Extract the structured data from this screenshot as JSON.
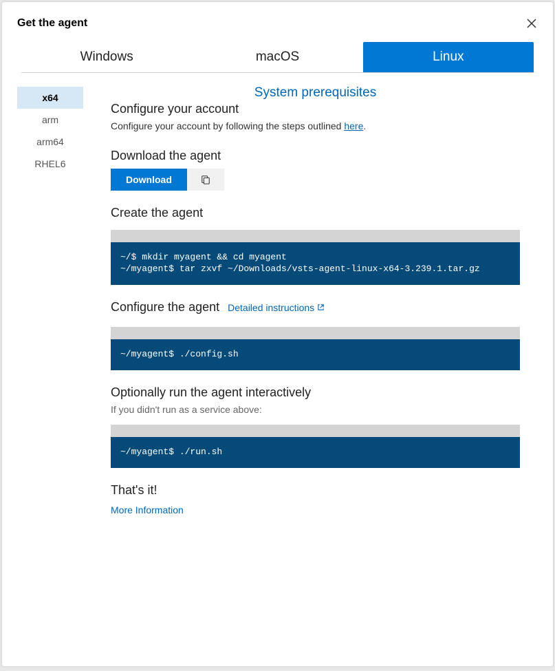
{
  "header": {
    "title": "Get the agent"
  },
  "tabs": [
    "Windows",
    "macOS",
    "Linux"
  ],
  "sidebar": [
    "x64",
    "arm",
    "arm64",
    "RHEL6"
  ],
  "sysPrereq": "System prerequisites",
  "configureAccount": {
    "title": "Configure your account",
    "desc_pre": "Configure your account by following the steps outlined ",
    "desc_link": "here",
    "desc_post": "."
  },
  "download": {
    "title": "Download the agent",
    "button": "Download"
  },
  "create": {
    "title": "Create the agent",
    "code": "~/$ mkdir myagent && cd myagent\n~/myagent$ tar zxvf ~/Downloads/vsts-agent-linux-x64-3.239.1.tar.gz"
  },
  "configureAgent": {
    "title": "Configure the agent",
    "detailed": "Detailed instructions",
    "code": "~/myagent$ ./config.sh"
  },
  "optional": {
    "title": "Optionally run the agent interactively",
    "note": "If you didn't run as a service above:",
    "code": "~/myagent$ ./run.sh"
  },
  "thatsIt": {
    "title": "That's it!",
    "more": "More Information"
  }
}
